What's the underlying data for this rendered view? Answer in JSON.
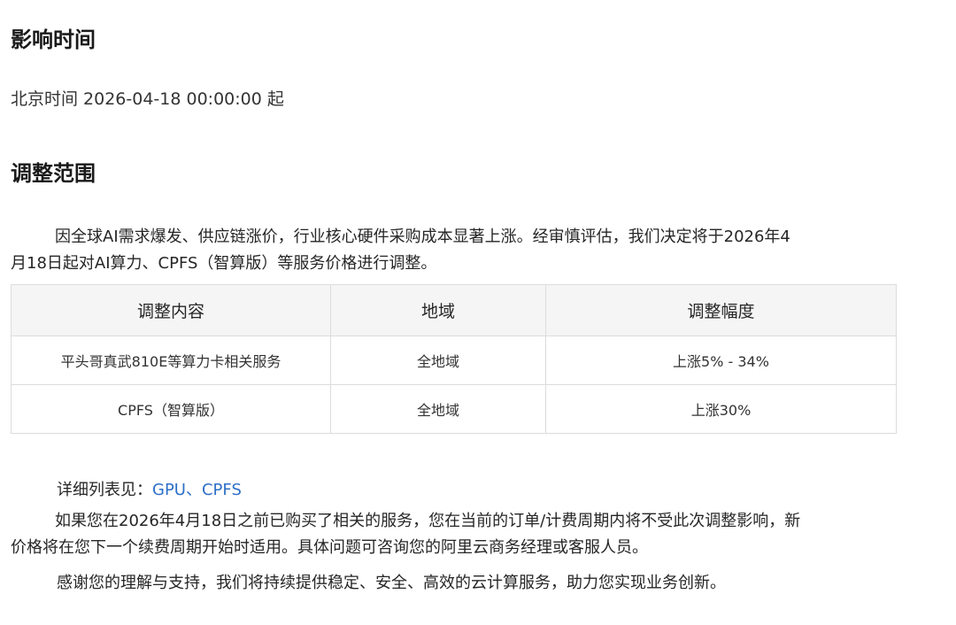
{
  "section1": {
    "title": "影响时间",
    "time_text": "北京时间 2026-04-18 00:00:00 起"
  },
  "section2": {
    "title": "调整范围",
    "intro_line1": "因全球AI需求爆发、供应链涨价，行业核心硬件采购成本显著上涨。经审慎评估，我们决定将于2026年4",
    "intro_line2": "月18日起对AI算力、CPFS（智算版）等服务价格进行调整。"
  },
  "table": {
    "headers": [
      "调整内容",
      "地域",
      "调整幅度"
    ],
    "rows": [
      [
        "平头哥真武810E等算力卡相关服务",
        "全地域",
        "上涨5% - 34%"
      ],
      [
        "CPFS（智算版）",
        "全地域",
        "上涨30%"
      ]
    ]
  },
  "details": {
    "label": "详细列表见：",
    "link_gpu": "GPU",
    "separator": "、",
    "link_cpfs": "CPFS",
    "note_line1": "如果您在2026年4月18日之前已购买了相关的服务，您在当前的订单/计费周期内将不受此次调整影响，新",
    "note_line2": "价格将在您下一个续费周期开始时适用。具体问题可咨询您的阿里云商务经理或客服人员。",
    "thanks": "感谢您的理解与支持，我们将持续提供稳定、安全、高效的云计算服务，助力您实现业务创新。"
  },
  "colors": {
    "link": "#2e6fc7",
    "header_bg": "#f5f5f5",
    "border": "#dcdcdc"
  }
}
